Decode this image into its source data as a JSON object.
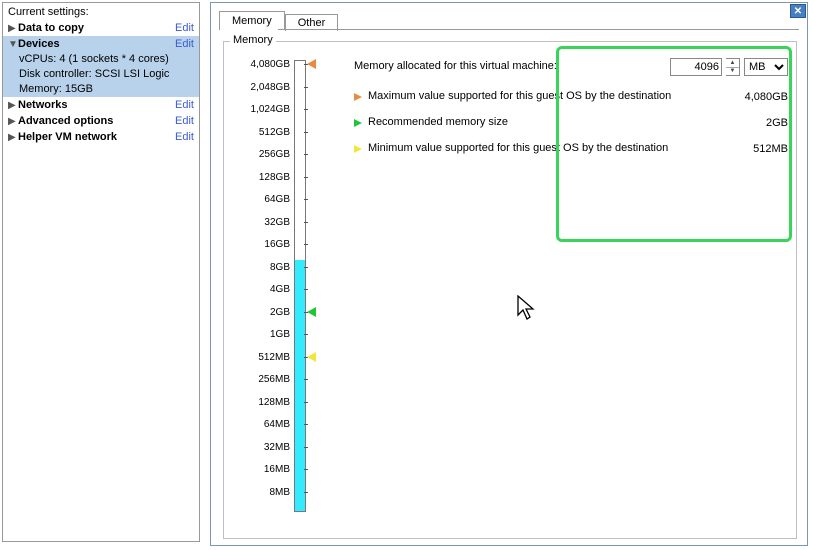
{
  "left": {
    "title": "Current settings:",
    "items": [
      {
        "label": "Data to copy",
        "bold": true,
        "arrow": "right",
        "edit": "Edit",
        "selected": false
      },
      {
        "label": "Devices",
        "bold": true,
        "arrow": "down",
        "edit": "Edit",
        "selected": true,
        "children": [
          "vCPUs: 4 (1 sockets * 4 cores)",
          "Disk controller: SCSI LSI Logic",
          "Memory: 15GB"
        ]
      },
      {
        "label": "Networks",
        "bold": true,
        "arrow": "right",
        "edit": "Edit",
        "selected": false
      },
      {
        "label": "Advanced options",
        "bold": true,
        "arrow": "right",
        "edit": "Edit",
        "selected": false
      },
      {
        "label": "Helper VM network",
        "bold": true,
        "arrow": "right",
        "edit": "Edit",
        "selected": false
      }
    ]
  },
  "tabs": {
    "active": "Memory",
    "inactive": "Other"
  },
  "memory": {
    "legend": "Memory",
    "allocated_label": "Memory allocated for this virtual machine:",
    "allocated_value": "4096",
    "allocated_unit": "MB",
    "max_label": "Maximum value supported for this guest OS by the destination",
    "max_value": "4,080GB",
    "rec_label": "Recommended memory size",
    "rec_value": "2GB",
    "min_label": "Minimum value supported for this guest OS by the destination",
    "min_value": "512MB",
    "scale_labels": [
      "4,080GB",
      "2,048GB",
      "1,024GB",
      "512GB",
      "256GB",
      "128GB",
      "64GB",
      "32GB",
      "16GB",
      "8GB",
      "4GB",
      "2GB",
      "1GB",
      "512MB",
      "256MB",
      "128MB",
      "64MB",
      "32MB",
      "16MB",
      "8MB"
    ],
    "scale_current_idx": 8,
    "marker_max_idx": 0,
    "marker_rec_idx": 11,
    "marker_min_idx": 13
  }
}
